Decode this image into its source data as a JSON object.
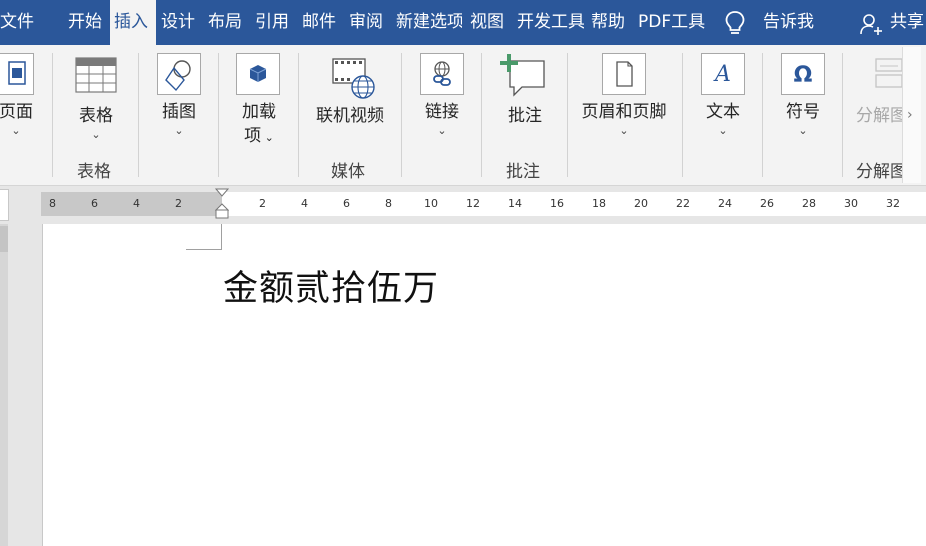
{
  "tabs": [
    {
      "label": "文件",
      "active": false
    },
    {
      "label": "开始",
      "active": false
    },
    {
      "label": "插入",
      "active": true
    },
    {
      "label": "设计",
      "active": false
    },
    {
      "label": "布局",
      "active": false
    },
    {
      "label": "引用",
      "active": false
    },
    {
      "label": "邮件",
      "active": false
    },
    {
      "label": "审阅",
      "active": false
    },
    {
      "label": "新建选项",
      "active": false
    },
    {
      "label": "视图",
      "active": false
    },
    {
      "label": "开发工具",
      "active": false
    },
    {
      "label": "帮助",
      "active": false
    },
    {
      "label": "PDF工具",
      "active": false
    }
  ],
  "tell_me": "告诉我",
  "share": "共享",
  "ribbon": {
    "pages": "页面",
    "table": "表格",
    "illustrations": "插图",
    "addins_line1": "加载",
    "addins_line2": "项",
    "online_video": "联机视频",
    "link": "链接",
    "comment": "批注",
    "header_footer": "页眉和页脚",
    "text": "文本",
    "symbols": "符号",
    "decompose": "分解图",
    "groups": {
      "table": "表格",
      "media": "媒体",
      "comments": "批注",
      "decompose": "分解图"
    }
  },
  "ruler": {
    "left_ticks": [
      "8",
      "6",
      "4",
      "2"
    ],
    "right_ticks": [
      "2",
      "4",
      "6",
      "8",
      "10",
      "12",
      "14",
      "16",
      "18",
      "20",
      "22",
      "24",
      "26",
      "28",
      "30",
      "32"
    ]
  },
  "document": {
    "text": "金额贰拾伍万"
  },
  "colors": {
    "title_bar": "#2b579a",
    "ribbon_bg": "#f3f3f3",
    "accent_blue": "#2b579a"
  }
}
